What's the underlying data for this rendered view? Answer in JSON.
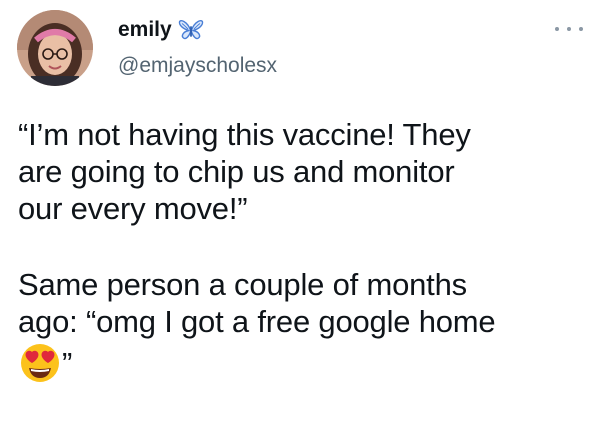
{
  "user": {
    "display_name": "emily",
    "handle": "@emjayscholesx",
    "badge_icon": "butterfly-icon"
  },
  "menu": {
    "icon": "more-icon"
  },
  "tweet": {
    "paragraph1": [
      "“I’m not having this vaccine! They",
      "are going to chip us and monitor",
      "our every move!”"
    ],
    "paragraph2": [
      "Same person a couple of months",
      "ago: “omg I got a free google home"
    ],
    "paragraph2_end_quote": "”",
    "emoji": "heart-eyes-emoji"
  },
  "colors": {
    "text": "#0f1419",
    "secondary": "#536471",
    "butterfly": "#4a7fd6",
    "emoji_face": "#fcc21b",
    "emoji_heart": "#e0283c"
  }
}
